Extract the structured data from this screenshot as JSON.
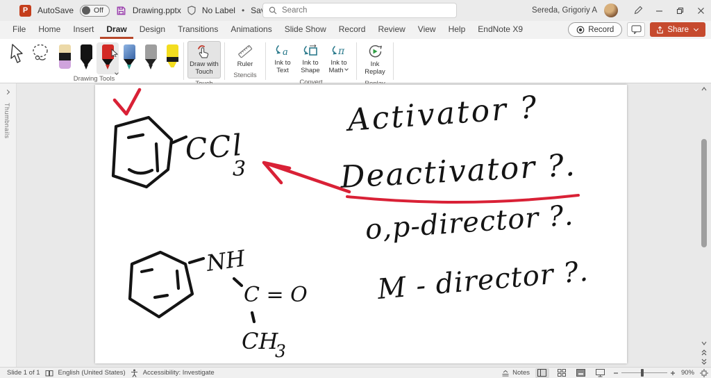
{
  "title_bar": {
    "autosave_label": "AutoSave",
    "autosave_state": "Off",
    "file_name": "Drawing.pptx",
    "sensitivity_label": "No Label",
    "separator": "•",
    "save_status": "Saved to this PC",
    "search_placeholder": "Search",
    "user_name": "Sereda, Grigoriy A"
  },
  "icons": {
    "app_glyph": "P",
    "ink_text_glyph": "a",
    "ink_math_glyph": "π"
  },
  "tabs": [
    "File",
    "Home",
    "Insert",
    "Draw",
    "Design",
    "Transitions",
    "Animations",
    "Slide Show",
    "Record",
    "Review",
    "View",
    "Help",
    "EndNote X9"
  ],
  "active_tab": "Draw",
  "top_actions": {
    "record": "Record",
    "share": "Share"
  },
  "ribbon": {
    "groups": [
      {
        "label": "Drawing Tools"
      },
      {
        "label": "Touch"
      },
      {
        "label": "Stencils"
      },
      {
        "label": "Convert"
      },
      {
        "label": "Replay"
      }
    ],
    "buttons": {
      "draw_with_touch": "Draw with Touch",
      "ruler": "Ruler",
      "ink_to_text": "Ink to Text",
      "ink_to_shape": "Ink to Shape",
      "ink_to_math": "Ink to Math",
      "ink_replay": "Ink Replay"
    }
  },
  "thumbnails_label": "Thumbnails",
  "slide_ink": {
    "question1": "Activator ?",
    "question2": "Deactivator ?.",
    "question3": "o,p-director ?.",
    "question4": "M - director ?.",
    "formula_ccl": {
      "main": "CCl",
      "sub": "3"
    },
    "label_nh": "NH",
    "label_co": "C = O",
    "formula_ch": {
      "main": "CH",
      "sub": "3"
    },
    "ink_red": "#d92136",
    "ink_black": "#141414"
  },
  "status_bar": {
    "slide_indicator": "Slide 1 of 1",
    "language": "English (United States)",
    "accessibility": "Accessibility: Investigate",
    "notes_label": "Notes",
    "zoom_level": "90%"
  }
}
